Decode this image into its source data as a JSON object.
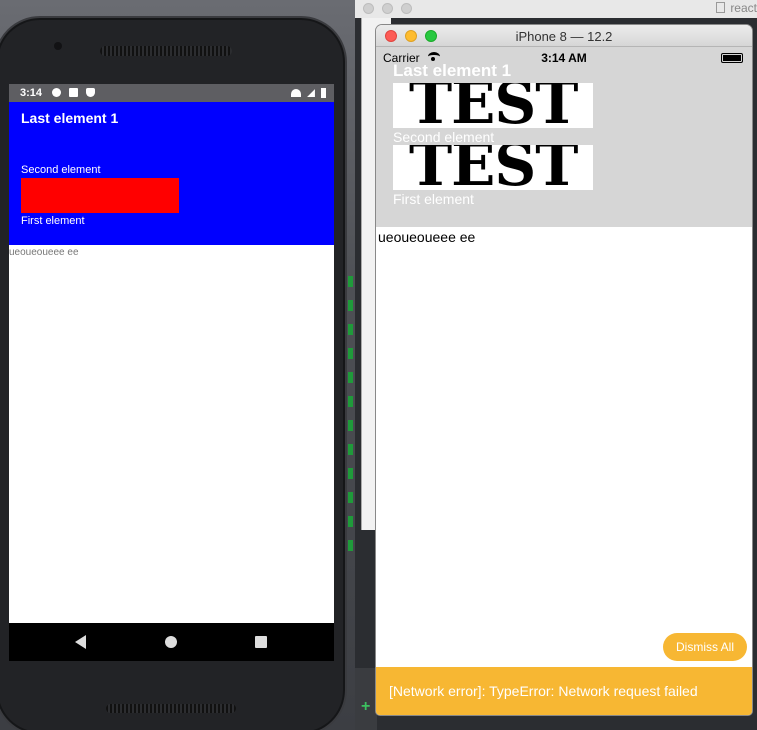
{
  "background": {
    "editor_tab": "react"
  },
  "android": {
    "status_time": "3:14",
    "header_title": "Last element 1",
    "second_label": "Second element",
    "first_label": "First element",
    "body_text": "ueoueoueee ee",
    "colors": {
      "header_bg": "#0000ff",
      "box": "#ff0000",
      "status_bg": "#5e5e62"
    }
  },
  "ios": {
    "window_title": "iPhone 8 — 12.2",
    "carrier": "Carrier",
    "status_time": "3:14 AM",
    "header_title": "Last element 1",
    "image_text": "TEST",
    "second_label": "Second element",
    "first_label": "First element",
    "body_text": "ueoueoueee ee",
    "dismiss_label": "Dismiss All",
    "error_message": "[Network error]: TypeError: Network request failed",
    "colors": {
      "header_bg": "#d6d6d6",
      "warning": "#f7b733"
    }
  }
}
